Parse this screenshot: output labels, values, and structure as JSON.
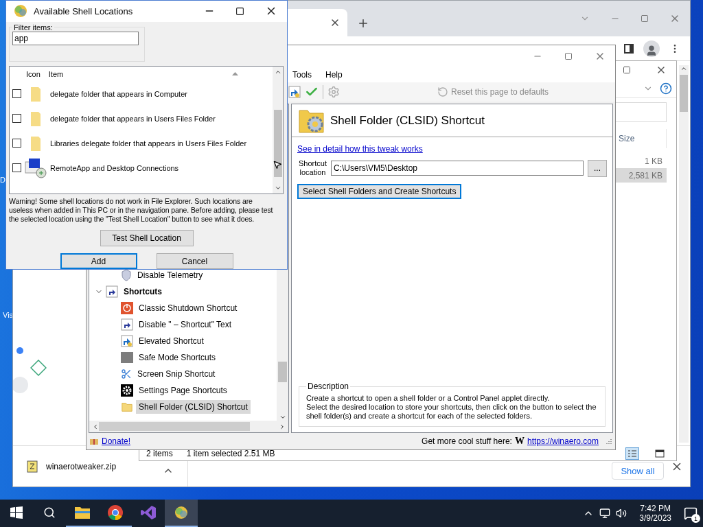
{
  "desktop": {
    "labels": [
      "D",
      "Vis"
    ]
  },
  "browser": {
    "download": {
      "file": "winaerotweaker.zip",
      "show_all": "Show all"
    }
  },
  "explorer": {
    "columns": [
      "Size"
    ],
    "rows": [
      {
        "size": "1 KB",
        "selected": false
      },
      {
        "size": "2,581 KB",
        "selected": true
      }
    ],
    "status": {
      "items": "2 items",
      "selection": "1 item selected  2.51 MB"
    }
  },
  "tweaker": {
    "menu": [
      "Tools",
      "Help"
    ],
    "reset": "Reset this page to defaults",
    "tree": [
      {
        "label": "Disable Telemetry",
        "kind": "shield",
        "selected": false
      },
      {
        "label": "Shortcuts",
        "kind": "shortcut",
        "selected": false,
        "expanded": true,
        "children": [
          {
            "label": "Classic Shutdown Shortcut",
            "kind": "power",
            "selected": false
          },
          {
            "label": "Disable \" – Shortcut\" Text",
            "kind": "shortcut",
            "selected": false
          },
          {
            "label": "Elevated Shortcut",
            "kind": "elevated",
            "selected": false
          },
          {
            "label": "Safe Mode Shortcuts",
            "kind": "safe",
            "selected": false
          },
          {
            "label": "Screen Snip Shortcut",
            "kind": "scissors",
            "selected": false
          },
          {
            "label": "Settings Page Shortcuts",
            "kind": "gear",
            "selected": false
          },
          {
            "label": "Shell Folder (CLSID) Shortcut",
            "kind": "folder",
            "selected": true
          }
        ]
      }
    ],
    "page": {
      "title": "Shell Folder (CLSID) Shortcut",
      "link": "See in detail how this tweak works",
      "field_label": "Shortcut\nlocation",
      "field_value": "C:\\Users\\VM5\\Desktop",
      "browse": "...",
      "action": "Select Shell Folders and Create Shortcuts",
      "description_title": "Description",
      "description": "Create a shortcut to open a shell folder or a Control Panel applet directly.\nSelect the desired location to store your shortcuts, then click on the button to select the\nshell folder(s) and create a shortcut for each of the selected folders."
    },
    "footer": {
      "donate": "Donate!",
      "promo": "Get more cool stuff here:",
      "logo": "W",
      "url": "https://winaero.com"
    }
  },
  "dialog": {
    "title": "Available Shell Locations",
    "filter_label": "Filter items:",
    "filter_value": "app",
    "columns": [
      "Icon",
      "Item"
    ],
    "rows": [
      {
        "kind": "folder",
        "label": "delegate folder that appears in Computer",
        "checked": false
      },
      {
        "kind": "folder",
        "label": "delegate folder that appears in Users Files Folder",
        "checked": false
      },
      {
        "kind": "folder",
        "label": "Libraries delegate folder that appears in Users Files Folder",
        "checked": false
      },
      {
        "kind": "remote",
        "label": "RemoteApp and Desktop Connections",
        "checked": false
      }
    ],
    "warning": "Warning! Some shell locations do not work in File Explorer. Such locations are\nuseless when added in This PC or in the navigation pane. Before adding, please test\nthe selected location using the \"Test Shell Location\" button to see what it does.",
    "test_button": "Test Shell Location",
    "buttons": [
      {
        "label": "Add",
        "default": true
      },
      {
        "label": "Cancel",
        "default": false
      }
    ]
  },
  "taskbar": {
    "apps": [
      {
        "kind": "explorer",
        "running": true,
        "selected": false
      },
      {
        "kind": "chrome",
        "running": true,
        "selected": false
      },
      {
        "kind": "studio",
        "running": false,
        "selected": false
      },
      {
        "kind": "tweaker",
        "running": true,
        "selected": true
      }
    ],
    "time": "7:42 PM",
    "date": "3/9/2023",
    "notifications": "1"
  }
}
